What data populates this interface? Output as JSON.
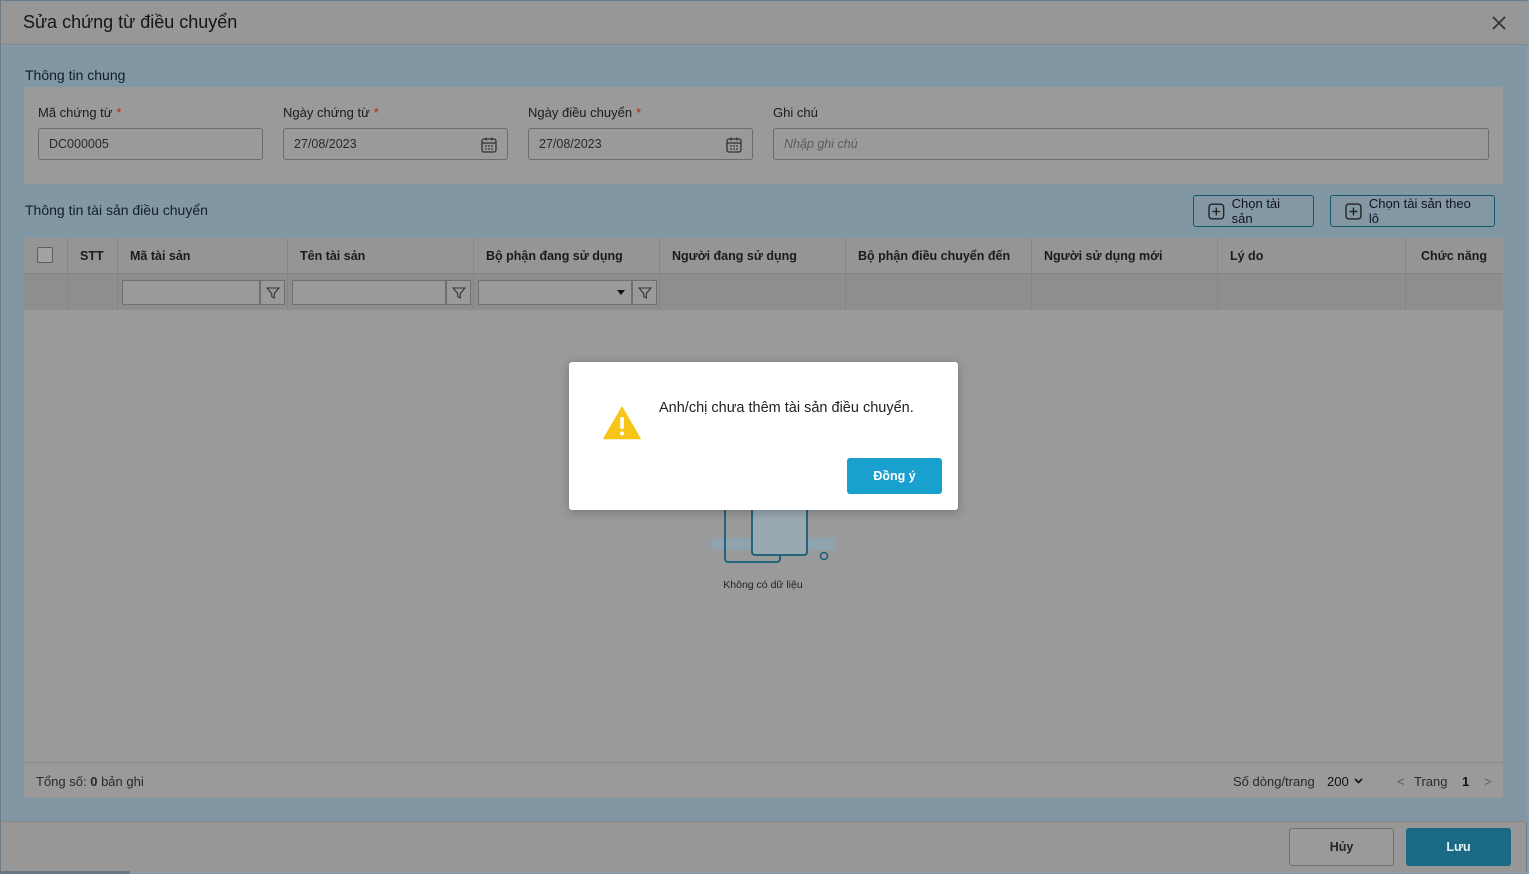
{
  "dialog": {
    "title": "Sửa chứng từ điều chuyển"
  },
  "general_section": {
    "title": "Thông tin chung",
    "fields": {
      "voucher_code": {
        "label": "Mã chứng từ",
        "required_mark": "*",
        "value": "DC000005"
      },
      "voucher_date": {
        "label": "Ngày chứng từ",
        "required_mark": "*",
        "value": "27/08/2023"
      },
      "transfer_date": {
        "label": "Ngày điều chuyển",
        "required_mark": "*",
        "value": "27/08/2023"
      },
      "note": {
        "label": "Ghi chú",
        "placeholder": "Nhập ghi chú"
      }
    }
  },
  "assets_section": {
    "title": "Thông tin tài sản điều chuyển",
    "select_asset_button": "Chọn tài sản",
    "select_batch_button": "Chọn tài sản theo lô"
  },
  "table": {
    "columns": [
      "STT",
      "Mã tài sản",
      "Tên tài sản",
      "Bộ phận đang sử dụng",
      "Người đang sử dụng",
      "Bộ phận điều chuyển đến",
      "Người sử dụng mới",
      "Lý do",
      "Chức năng"
    ],
    "empty_text": "Không có dữ liệu"
  },
  "footer": {
    "total_label": "Tổng số:",
    "total_count": "0",
    "total_unit": "bản ghi",
    "rows_per_page_label": "Số dòng/trang",
    "rows_per_page_value": "200",
    "page_label": "Trang",
    "page_number": "1",
    "prev": "<",
    "next": ">"
  },
  "actions": {
    "cancel": "Hủy",
    "save": "Lưu"
  },
  "alert": {
    "message": "Anh/chị chưa thêm tài sản điều chuyển.",
    "ok_button": "Đồng ý"
  },
  "colors": {
    "primary": "#1aa0cf",
    "save": "#1a6a86",
    "warning": "#f5c518"
  }
}
